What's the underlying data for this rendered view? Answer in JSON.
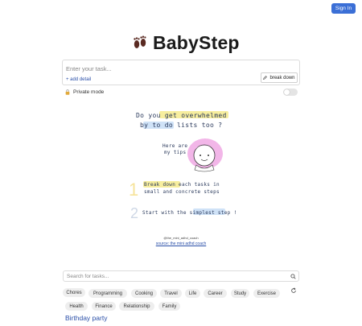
{
  "header": {
    "sign_in_label": "Sign In"
  },
  "logo": {
    "icon": "footprints-icon",
    "title": "BabyStep"
  },
  "task": {
    "placeholder": "Enter your task...",
    "add_detail_label": "+ add detail",
    "break_down_label": "break down",
    "break_down_icon": "pencil-icon"
  },
  "privacy": {
    "label": "Private mode",
    "icon": "lock-icon",
    "enabled": false
  },
  "tips_image": {
    "line1": "Do you get overwhelmed",
    "line2": "by to do lists too ?",
    "aside1": "Here are",
    "aside2": "my tips",
    "tip1_number": "1",
    "tip1_line1": "Break down each tasks in",
    "tip1_line2": "small and concrete steps",
    "tip2_number": "2",
    "tip2_line": "Start with the simplest step !",
    "handle": "@the_mini_adhd_coach",
    "source": "source: the mini adhd coach"
  },
  "search": {
    "placeholder": "Search for tasks...",
    "icon": "search-icon"
  },
  "categories_row1": [
    "Chores",
    "Programming",
    "Cooking",
    "Travel",
    "Life",
    "Career",
    "Study",
    "Exercise"
  ],
  "categories_row2": [
    "Health",
    "Finance",
    "Relationship",
    "Family"
  ],
  "refresh_icon": "refresh-icon",
  "section": {
    "title": "Birthday party"
  },
  "colors": {
    "accent": "#3b6fd6",
    "link": "#2a4fa8",
    "highlight_yellow": "#f7ee9e",
    "highlight_blue": "#cfe2f7",
    "avatar_pink": "#f2b6e8"
  }
}
